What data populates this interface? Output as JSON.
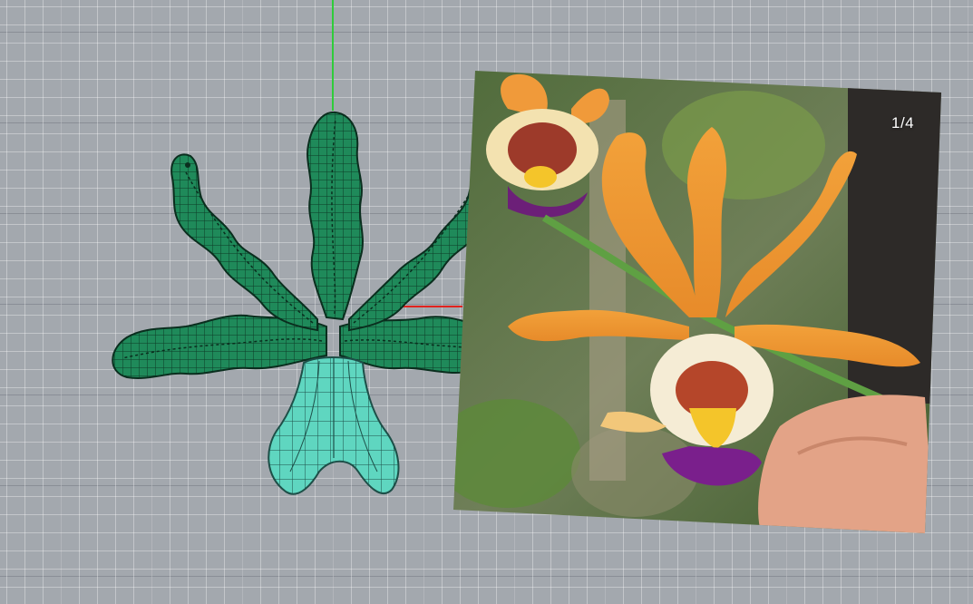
{
  "viewport": {
    "background": "#a3a8ae",
    "grid_color": "#c6cacf",
    "axis_y_color": "#2fcc3a",
    "axis_x_color": "#e0231f"
  },
  "model": {
    "petal_color": "#1f8a5a",
    "petal_mesh_color": "#0e3b27",
    "lip_color": "#5fd6c0",
    "lip_mesh_color": "#1d4f48"
  },
  "reference_image": {
    "counter": "1/4"
  }
}
